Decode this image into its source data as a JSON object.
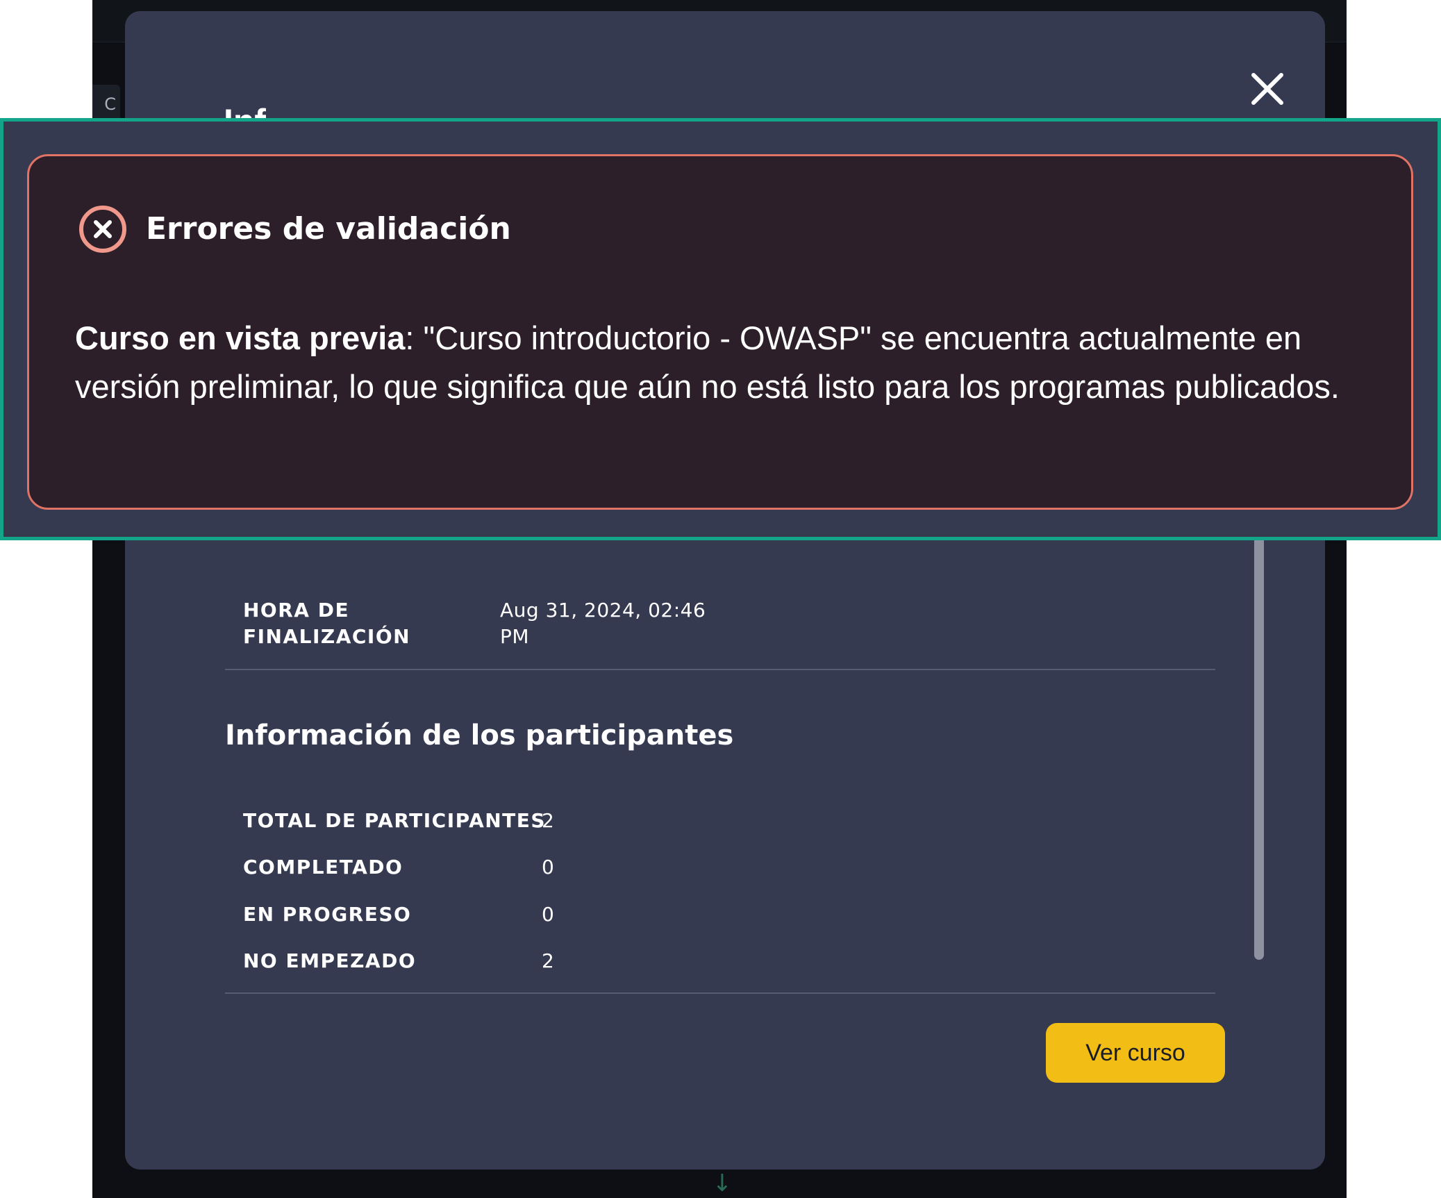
{
  "modal": {
    "title": "Inf",
    "close_icon": "close-icon",
    "schedule": {
      "end_label_line1": "HORA DE",
      "end_label_line2": "FINALIZACIÓN",
      "end_value_line1": "Aug 31, 2024, 02:46",
      "end_value_line2": "PM"
    },
    "participants": {
      "section_title": "Información de los participantes",
      "rows": [
        {
          "label": "TOTAL DE PARTICIPANTES",
          "value": "2"
        },
        {
          "label": "COMPLETADO",
          "value": "0"
        },
        {
          "label": "EN PROGRESO",
          "value": "0"
        },
        {
          "label": "NO EMPEZADO",
          "value": "2"
        }
      ]
    },
    "view_course_label": "Ver curso"
  },
  "error_banner": {
    "icon": "error-circle-x-icon",
    "title": "Errores de validación",
    "message_strong": "Curso en vista previa",
    "message_rest": ": \"Curso introductorio - OWASP\" se encuentra actualmente en versión preliminar, lo que significa que aún no está listo para los programas publicados."
  },
  "background": {
    "chip_text": "C"
  },
  "colors": {
    "modal_bg": "#353a50",
    "error_border": "#e07366",
    "error_bg": "#2c1f29",
    "highlight": "#12a58a",
    "button": "#f2bd14"
  }
}
